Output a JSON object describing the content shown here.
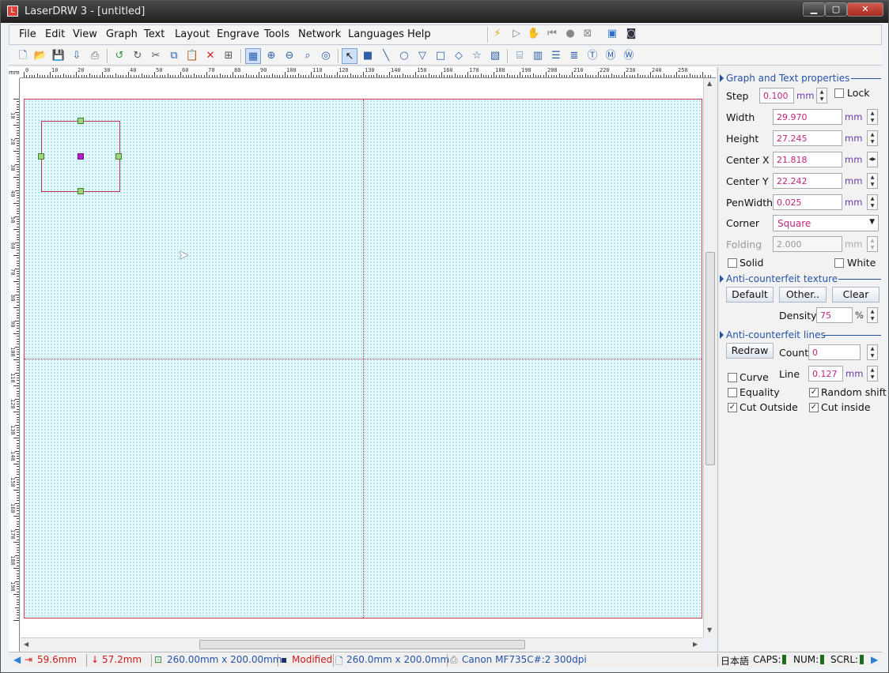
{
  "window": {
    "title": "LaserDRW 3 - [untitled]",
    "icon_text": "L",
    "min_glyph": "▁",
    "max_glyph": "▢",
    "close_glyph": "✕"
  },
  "menu": [
    "File",
    "Edit",
    "View",
    "Graph",
    "Text",
    "Layout",
    "Engrave",
    "Tools",
    "Network",
    "Languages",
    "Help"
  ],
  "ruler": {
    "unit": "mm",
    "top_labels": [
      "0",
      "10",
      "20",
      "30",
      "40",
      "50",
      "60",
      "70",
      "80",
      "90",
      "100",
      "110",
      "120",
      "130",
      "140",
      "150",
      "160",
      "170",
      "180",
      "190",
      "200",
      "210",
      "220",
      "230",
      "240",
      "250"
    ],
    "left_labels": [
      "10",
      "20",
      "30",
      "40",
      "50",
      "60",
      "70",
      "80",
      "90",
      "100",
      "110",
      "120",
      "130",
      "140",
      "150",
      "160",
      "170",
      "180",
      "190"
    ]
  },
  "panel": {
    "graph_text": {
      "title": "Graph and Text properties",
      "step_label": "Step",
      "step_value": "0.100",
      "step_unit": "mm",
      "lock_label": "Lock",
      "width_label": "Width",
      "width_value": "29.970",
      "width_unit": "mm",
      "height_label": "Height",
      "height_value": "27.245",
      "height_unit": "mm",
      "cx_label": "Center X",
      "cx_value": "21.818",
      "cx_unit": "mm",
      "cy_label": "Center Y",
      "cy_value": "22.242",
      "cy_unit": "mm",
      "pen_label": "PenWidth",
      "pen_value": "0.025",
      "pen_unit": "mm",
      "corner_label": "Corner",
      "corner_value": "Square",
      "folding_label": "Folding",
      "folding_value": "2.000",
      "folding_unit": "mm",
      "solid_label": "Solid",
      "white_label": "White"
    },
    "texture": {
      "title": "Anti-counterfeit texture",
      "default_label": "Default",
      "other_label": "Other..",
      "clear_label": "Clear",
      "density_label": "Density",
      "density_value": "75",
      "density_unit": "%"
    },
    "lines": {
      "title": "Anti-counterfeit lines",
      "redraw_label": "Redraw",
      "count_label": "Count",
      "count_value": "0",
      "curve_label": "Curve",
      "line_label": "Line",
      "line_value": "0.127",
      "line_unit": "mm",
      "equality_label": "Equality",
      "random_label": "Random shift",
      "cut_outside_label": "Cut Outside",
      "cut_inside_label": "Cut inside"
    }
  },
  "status": {
    "x": "59.6mm",
    "y": "57.2mm",
    "area": "260.00mm x 200.00mm",
    "modified": "Modified",
    "page": "260.0mm x 200.0mm",
    "printer": "Canon MF735C#:2 300dpi",
    "lang": "日本語",
    "caps": "CAPS:",
    "num": "NUM:",
    "scrl": "SCRL:"
  }
}
